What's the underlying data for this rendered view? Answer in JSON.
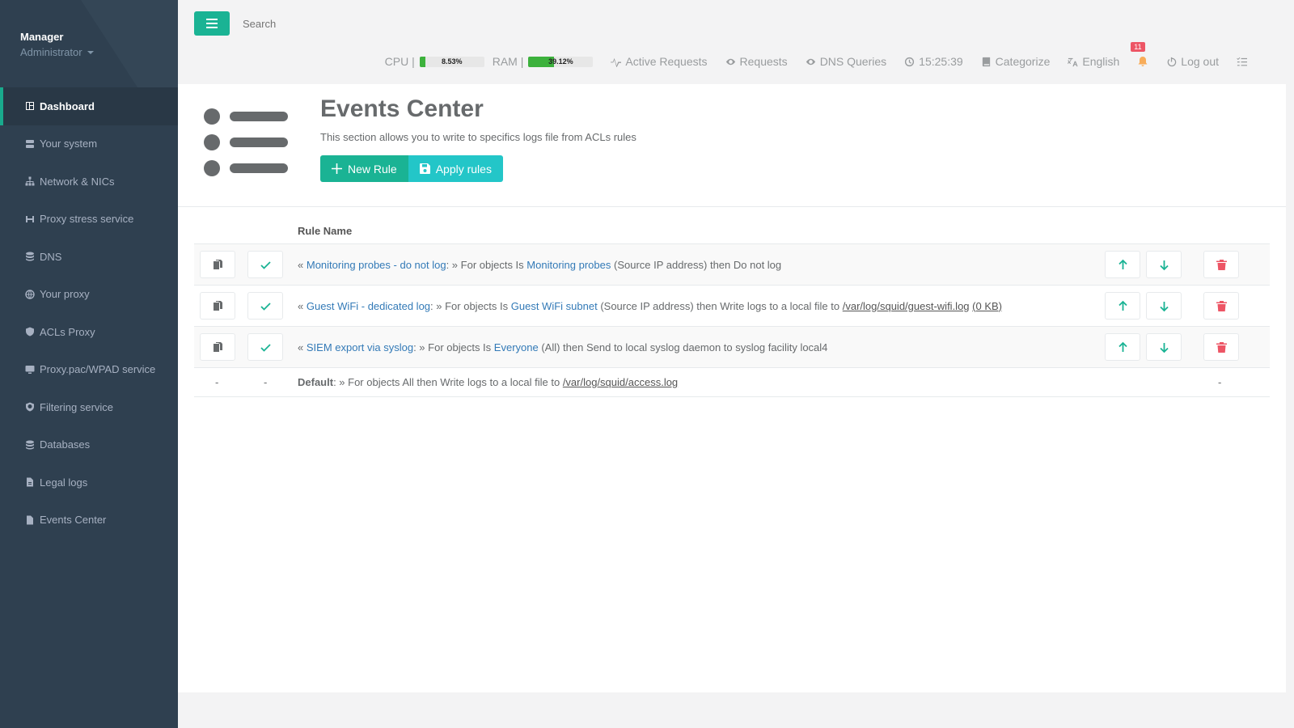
{
  "user": {
    "name": "Manager",
    "role": "Administrator"
  },
  "sidebar": {
    "items": [
      {
        "label": "Dashboard",
        "icon": "dashboard-icon",
        "active": true
      },
      {
        "label": "Your system",
        "icon": "server-icon"
      },
      {
        "label": "Network & NICs",
        "icon": "network-icon"
      },
      {
        "label": "Proxy stress service",
        "icon": "stress-icon"
      },
      {
        "label": "DNS",
        "icon": "database-icon"
      },
      {
        "label": "Your proxy",
        "icon": "globe-icon"
      },
      {
        "label": "ACLs Proxy",
        "icon": "shield-icon"
      },
      {
        "label": "Proxy.pac/WPAD service",
        "icon": "monitor-icon"
      },
      {
        "label": "Filtering service",
        "icon": "shield-check-icon"
      },
      {
        "label": "Databases",
        "icon": "database-icon"
      },
      {
        "label": "Legal logs",
        "icon": "file-icon"
      },
      {
        "label": "Events Center",
        "icon": "document-icon"
      }
    ]
  },
  "topbar": {
    "search_placeholder": "Search",
    "cpu_label": "CPU |",
    "cpu_pct": "8.53%",
    "cpu_value": 8.53,
    "ram_label": "RAM |",
    "ram_pct": "39.12%",
    "ram_value": 39.12,
    "active_requests": "Active Requests",
    "requests": "Requests",
    "dns_queries": "DNS Queries",
    "clock": "15:25:39",
    "categorize": "Categorize",
    "language": "English",
    "notifications": "11",
    "logout": "Log out"
  },
  "page": {
    "title": "Events Center",
    "subtitle": "This section allows you to write to specifics logs file from ACLs rules",
    "new_rule": "New Rule",
    "apply_rules": "Apply rules"
  },
  "table": {
    "header": "Rule Name",
    "rows": [
      {
        "open": "«",
        "name": "Monitoring probes - do not log",
        "mid": ": » For objects Is",
        "object": "Monitoring probes",
        "rest": "(Source IP address) then Do not log",
        "path": "",
        "size": ""
      },
      {
        "open": "«",
        "name": "Guest WiFi - dedicated log",
        "mid": ": » For objects Is",
        "object": "Guest WiFi subnet",
        "rest": "(Source IP address) then Write logs to a local file to",
        "path": "/var/log/squid/guest-wifi.log",
        "size": "(0 KB)"
      },
      {
        "open": "«",
        "name": "SIEM export via syslog",
        "mid": ": » For objects Is",
        "object": "Everyone",
        "rest": "(All) then Send to local syslog daemon to syslog facility local4",
        "path": "",
        "size": ""
      }
    ],
    "default": {
      "dash": "-",
      "label": "Default",
      "text": ": » For objects All then Write logs to a local file to",
      "path": "/var/log/squid/access.log"
    }
  },
  "colors": {
    "sidebar_bg": "#2f4050",
    "accent": "#1ab394",
    "apply": "#23c6c8",
    "danger": "#ed5565",
    "link": "#337ab7"
  }
}
